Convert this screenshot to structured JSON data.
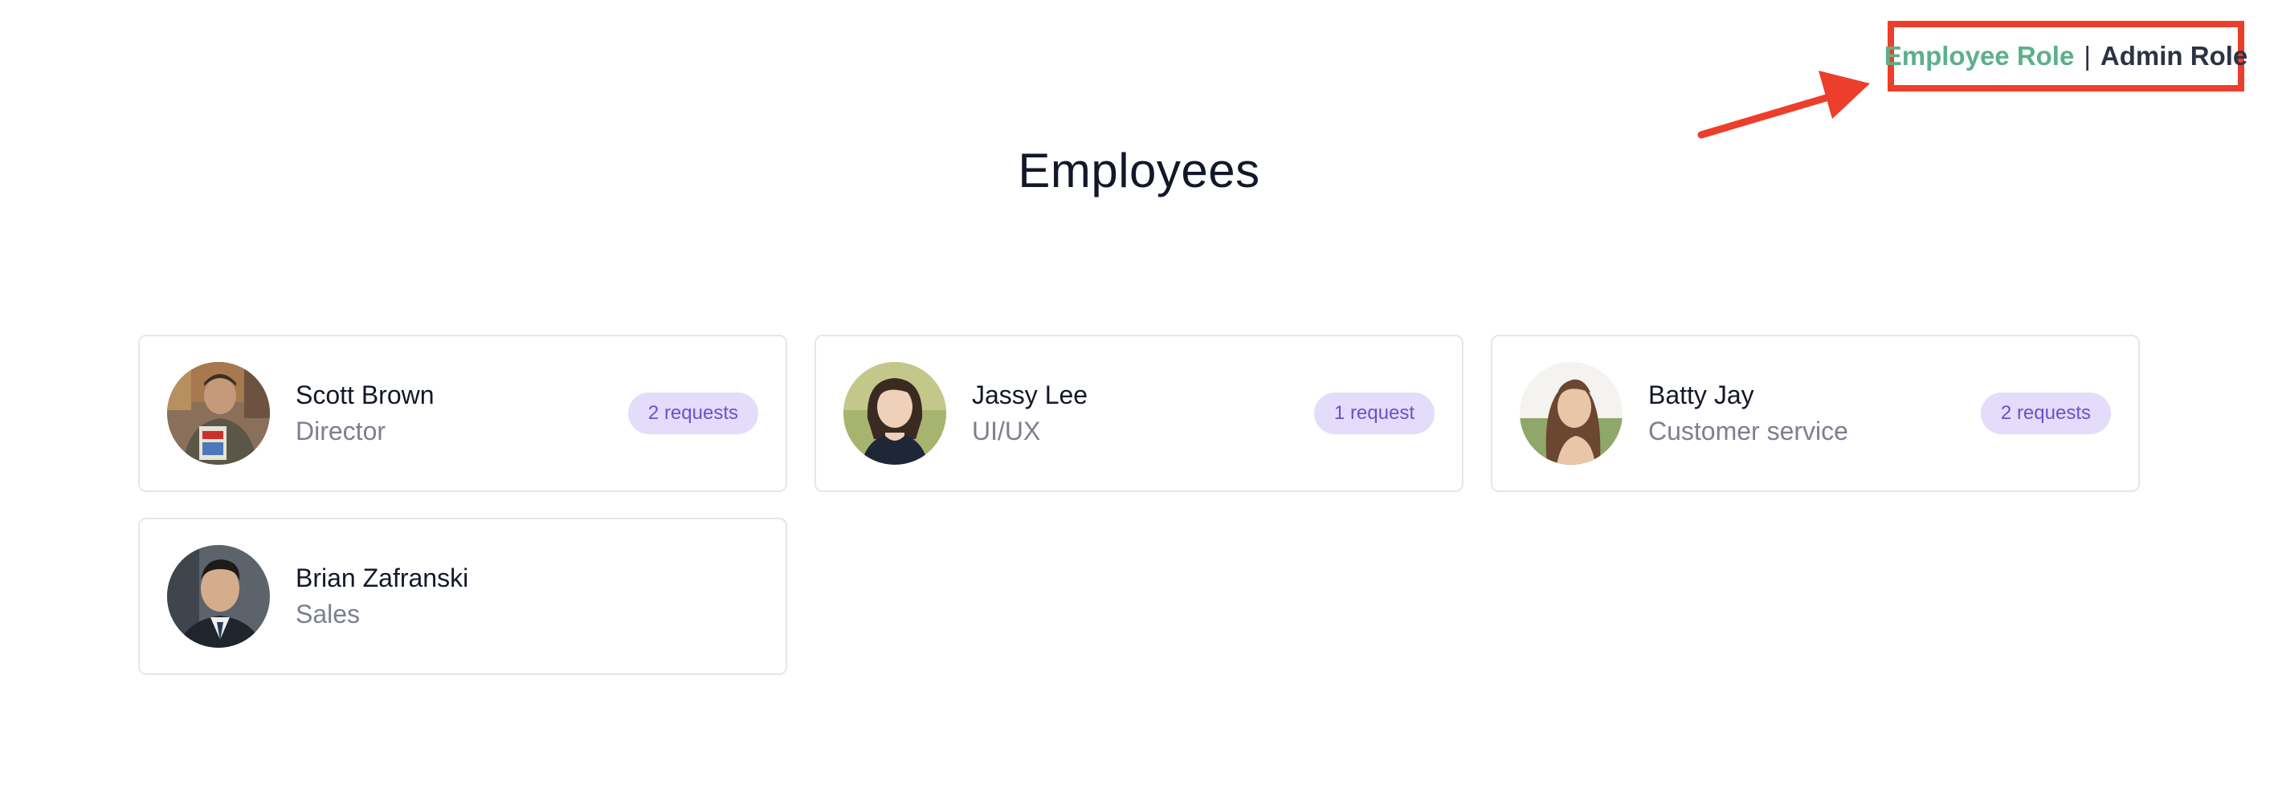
{
  "roles": {
    "employee_label": "Employee Role",
    "separator": "|",
    "admin_label": "Admin Role",
    "active_color": "#5cb08a",
    "highlight_color": "#ec3e2a"
  },
  "page": {
    "title": "Employees"
  },
  "employees": [
    {
      "name": "Scott Brown",
      "role": "Director",
      "requests": "2 requests",
      "avatar_icon": "person-photo-icon"
    },
    {
      "name": "Jassy Lee",
      "role": "UI/UX",
      "requests": "1 request",
      "avatar_icon": "person-photo-icon"
    },
    {
      "name": "Batty Jay",
      "role": "Customer service",
      "requests": "2 requests",
      "avatar_icon": "person-photo-icon"
    },
    {
      "name": "Brian Zafranski",
      "role": "Sales",
      "requests": null,
      "avatar_icon": "person-photo-icon"
    }
  ],
  "colors": {
    "badge_bg": "#e3dcfb",
    "badge_text": "#6b52c9",
    "card_border": "#e6e7eb"
  }
}
